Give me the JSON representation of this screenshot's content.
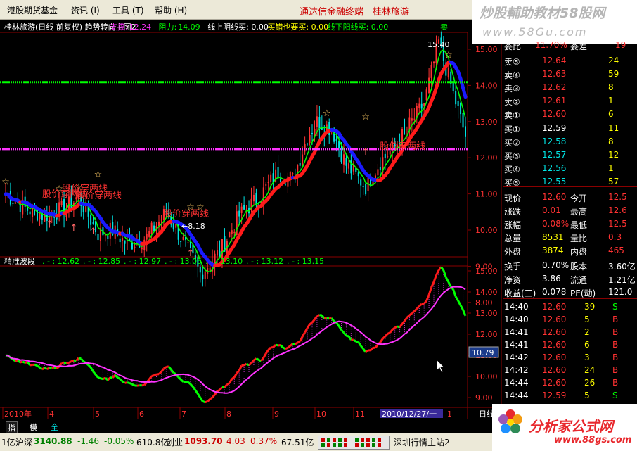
{
  "menu": {
    "items": [
      "港股期货基金",
      "资讯 (I)",
      "工具 (T)",
      "帮助 (H)"
    ],
    "center": "通达信金融终端",
    "stock": "桂林旅游"
  },
  "watermark": {
    "line1": "炒股輔助教材58股网",
    "line2": "www.58Gu.com"
  },
  "main": {
    "title": "桂林旅游(日线 前复权) 趋势转向主图2",
    "support_label": "支撑:",
    "support_value": "12.24",
    "resistance_label": "阻力:",
    "resistance_value": "14.09",
    "buy_label": "线上阴线买: 0.00",
    "wrong_label": "买错也要买: 0.00",
    "down_label": "线下阳线买: 0.00",
    "sell_label": "卖",
    "high_label": "15.40",
    "low_label": "←8.18",
    "annotations": [
      "股价穿两线",
      "股价穿两线",
      "股价穿两线",
      "股价穿两线",
      "股价穿两线"
    ],
    "yticks": [
      "15.00",
      "14.00",
      "13.00",
      "12.00",
      "11.00",
      "10.00",
      "9.00",
      "8.00"
    ]
  },
  "sub": {
    "title": "精准波段",
    "values": [
      ". - : 12.62",
      ". - : 12.85",
      ". - : 12.97",
      ". - : 13.05",
      ". - : 13.10",
      ". - : 13.12",
      ". - : 13.15"
    ],
    "yticks": [
      "15.00",
      "14.00",
      "13.00",
      "12.00",
      "11.00",
      "10.00",
      "9.00"
    ],
    "cursor_value": "10.79"
  },
  "xaxis": {
    "labels": [
      "2010年",
      "4",
      "5",
      "6",
      "7",
      "8",
      "9",
      "10",
      "11"
    ],
    "date_box": "2010/12/27/一",
    "period": "日线",
    "end_label": "1"
  },
  "orderbook": {
    "header": {
      "a": "委比",
      "b": "11.70%",
      "c": "委差",
      "d": "19"
    },
    "sell": [
      {
        "label": "卖⑤",
        "price": "12.64",
        "vol": "24"
      },
      {
        "label": "卖④",
        "price": "12.63",
        "vol": "59"
      },
      {
        "label": "卖③",
        "price": "12.62",
        "vol": "8"
      },
      {
        "label": "卖②",
        "price": "12.61",
        "vol": "1"
      },
      {
        "label": "卖①",
        "price": "12.60",
        "vol": "6"
      }
    ],
    "buy": [
      {
        "label": "买①",
        "price": "12.59",
        "vol": "11"
      },
      {
        "label": "买②",
        "price": "12.58",
        "vol": "8"
      },
      {
        "label": "买③",
        "price": "12.57",
        "vol": "12"
      },
      {
        "label": "买④",
        "price": "12.56",
        "vol": "1"
      },
      {
        "label": "买⑤",
        "price": "12.55",
        "vol": "57"
      }
    ]
  },
  "stats": [
    {
      "a": "现价",
      "b": "12.60",
      "c": "今开",
      "d": "12.5"
    },
    {
      "a": "涨跌",
      "b": "0.01",
      "c": "最高",
      "d": "12.6"
    },
    {
      "a": "涨幅",
      "b": "0.08%",
      "c": "最低",
      "d": "12.5"
    },
    {
      "a": "总量",
      "b": "8531",
      "c": "量比",
      "d": "0.3"
    },
    {
      "a": "外盘",
      "b": "3874",
      "c": "内盘",
      "d": "465"
    },
    {
      "a": "换手",
      "b": "0.70%",
      "c": "股本",
      "d": "3.60亿"
    },
    {
      "a": "净资",
      "b": "3.86",
      "c": "流通",
      "d": "1.21亿"
    },
    {
      "a": "收益(三)",
      "b": "0.078",
      "c": "PE(动)",
      "d": "121.0"
    }
  ],
  "ticks": [
    {
      "t": "14:40",
      "p": "12.60",
      "v": "39",
      "s": "S"
    },
    {
      "t": "14:40",
      "p": "12.60",
      "v": "5",
      "s": "B"
    },
    {
      "t": "14:41",
      "p": "12.60",
      "v": "2",
      "s": "B"
    },
    {
      "t": "14:41",
      "p": "12.60",
      "v": "6",
      "s": "B"
    },
    {
      "t": "14:42",
      "p": "12.60",
      "v": "3",
      "s": "B"
    },
    {
      "t": "14:42",
      "p": "12.60",
      "v": "24",
      "s": "B"
    },
    {
      "t": "14:44",
      "p": "12.60",
      "v": "26",
      "s": "B"
    },
    {
      "t": "14:44",
      "p": "12.59",
      "v": "5",
      "s": "S"
    },
    {
      "t": "14:44",
      "p": "12.60",
      "v": "2",
      "s": "B"
    },
    {
      "t": "14:44",
      "p": "12.60",
      "v": "75",
      "s": "B"
    },
    {
      "t": "14:45",
      "p": "12.60",
      "v": "20",
      "s": "B"
    }
  ],
  "tabs": [
    "指标",
    "模板",
    "全部"
  ],
  "ticker": {
    "t1": "1亿",
    "t2_label": "沪深",
    "t2_value": "3140.88",
    "t3": "-1.46",
    "t4": "-0.05%",
    "t5": "610.8亿",
    "t6_label": "创业",
    "t6_value": "1093.70",
    "t7": "4.03",
    "t8": "0.37%",
    "t9": "67.51亿",
    "t10": "深圳行情主站2"
  },
  "logo": {
    "cn": "分析家公式网",
    "url": "www.88gs.com"
  },
  "colors": {
    "up": "#ff3232",
    "down": "#00e4e4",
    "green": "#00ff00",
    "magenta": "#ff33ff",
    "yellow": "#ffff00",
    "blue": "#1a1aff",
    "grid": "#8b0000"
  }
}
